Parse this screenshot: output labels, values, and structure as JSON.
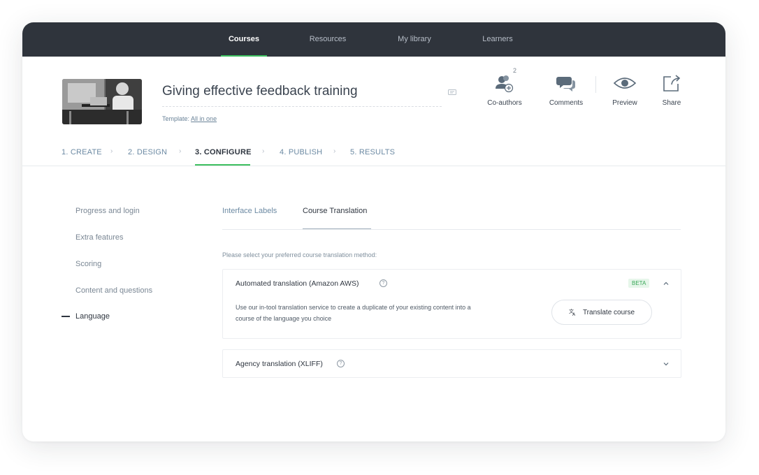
{
  "nav": {
    "items": [
      {
        "label": "Courses",
        "active": true
      },
      {
        "label": "Resources",
        "active": false
      },
      {
        "label": "My library",
        "active": false
      },
      {
        "label": "Learners",
        "active": false
      }
    ]
  },
  "course": {
    "title": "Giving effective feedback training",
    "template_prefix": "Template:",
    "template_name": "All in one"
  },
  "actions": {
    "coauthors_count": "2",
    "coauthors": "Co-authors",
    "comments": "Comments",
    "preview": "Preview",
    "share": "Share"
  },
  "steps": [
    {
      "label": "1. CREATE"
    },
    {
      "label": "2. DESIGN"
    },
    {
      "label": "3. CONFIGURE",
      "active": true
    },
    {
      "label": "4. PUBLISH"
    },
    {
      "label": "5. RESULTS"
    }
  ],
  "sidebar": {
    "items": [
      {
        "label": "Progress and login"
      },
      {
        "label": "Extra features"
      },
      {
        "label": "Scoring"
      },
      {
        "label": "Content and questions"
      },
      {
        "label": "Language",
        "active": true
      }
    ]
  },
  "tabs": [
    {
      "label": "Interface Labels"
    },
    {
      "label": "Course Translation",
      "active": true
    }
  ],
  "translation": {
    "instruction": "Please select your preferred course translation method:",
    "automated": {
      "title": "Automated translation (Amazon AWS)",
      "badge": "BETA",
      "description": "Use our in-tool translation service to create a duplicate of your existing content into a course of the language you choice",
      "button": "Translate course"
    },
    "agency": {
      "title": "Agency translation (XLIFF)"
    }
  },
  "colors": {
    "nav_bg": "#2f343c",
    "accent_green": "#3dbf5f",
    "link_blue": "#6c8aa3"
  }
}
